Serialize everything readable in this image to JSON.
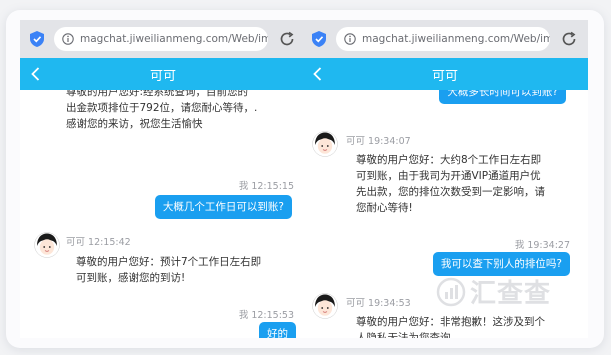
{
  "left": {
    "url": "magchat.jiweilianmeng.com/Web/im.as",
    "title": "可可",
    "messages": {
      "partial_line1": "尊敬的用户您好:经系统查询，目前您的",
      "partial_line2": "出金款项排位于792位，请您耐心等待，.",
      "partial_line3": "感谢您的来访，祝您生活愉快",
      "me_time_1": "我 12:15:15",
      "me_text_1": "大概几个工作日可以到账?",
      "agent_time": "可可 12:15:42",
      "agent_line1": "尊敬的用户您好：预计7个工作日左右即",
      "agent_line2": "可到账，感谢您的到访!",
      "me_time_2": "我 12:15:53",
      "me_text_2": "好的"
    }
  },
  "right": {
    "url": "magchat.jiweilianmeng.com/Web/im.as",
    "title": "可可",
    "messages": {
      "partial_bubble": "大概多长时间可以到账?",
      "agent_time_1": "可可 19:34:07",
      "agent1_line1": "尊敬的用户您好：大约8个工作日左右即",
      "agent1_line2": "可到账，由于我司为开通VIP通道用户优",
      "agent1_line3": "先出款，您的排位次数受到一定影响，请",
      "agent1_line4": "您耐心等待!",
      "me_time": "我 19:34:27",
      "me_text": "我可以查下别人的排位吗?",
      "agent_time_2": "可可 19:34:53",
      "agent2_line1": "尊敬的用户您好：非常抱歉！这涉及到个",
      "agent2_line2": "人隐私无法为您查询。"
    }
  },
  "watermark": {
    "text": "汇查查"
  },
  "colors": {
    "nav": "#1fb8f0",
    "bubble": "#1a9ff0",
    "urlbar": "#e3e4e8"
  },
  "icons": [
    "shield-icon",
    "info-icon",
    "reload-icon",
    "back-arrow-icon",
    "avatar-icon"
  ]
}
